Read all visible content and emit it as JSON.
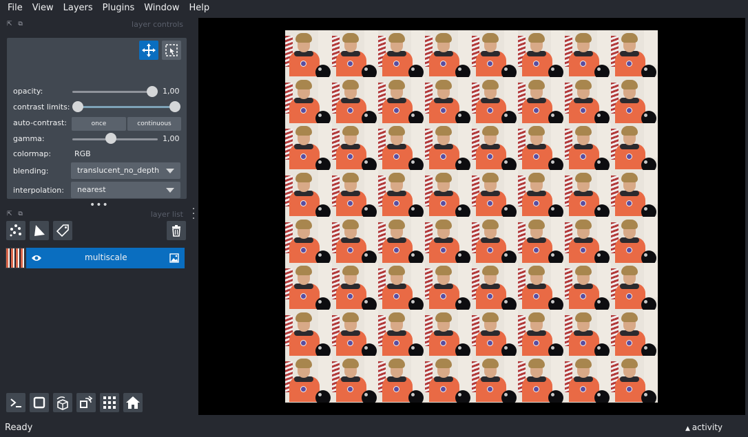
{
  "menu": [
    {
      "label": "File"
    },
    {
      "label": "View"
    },
    {
      "label": "Layers"
    },
    {
      "label": "Plugins"
    },
    {
      "label": "Window"
    },
    {
      "label": "Help"
    }
  ],
  "layer_controls": {
    "title": "layer controls",
    "opacity": {
      "label": "opacity:",
      "value": "1,00",
      "level": 1.0
    },
    "contrast_limits": {
      "label": "contrast limits:",
      "low": 0.0,
      "high": 1.0
    },
    "auto_contrast": {
      "label": "auto-contrast:",
      "once": "once",
      "continuous": "continuous"
    },
    "gamma": {
      "label": "gamma:",
      "value": "1,00",
      "level": 0.45
    },
    "colormap": {
      "label": "colormap:",
      "value": "RGB"
    },
    "blending": {
      "label": "blending:",
      "value": "translucent_no_depth"
    },
    "interpolation": {
      "label": "interpolation:",
      "value": "nearest"
    }
  },
  "layer_list": {
    "title": "layer list",
    "layers": [
      {
        "name": "multiscale",
        "visible": true
      }
    ]
  },
  "canvas": {
    "tile_rows": 8,
    "tile_cols": 8
  },
  "status": {
    "text": "Ready",
    "activity": "activity"
  },
  "colors": {
    "accent": "#0a6ec0",
    "panel": "#414851",
    "background": "#262930"
  }
}
